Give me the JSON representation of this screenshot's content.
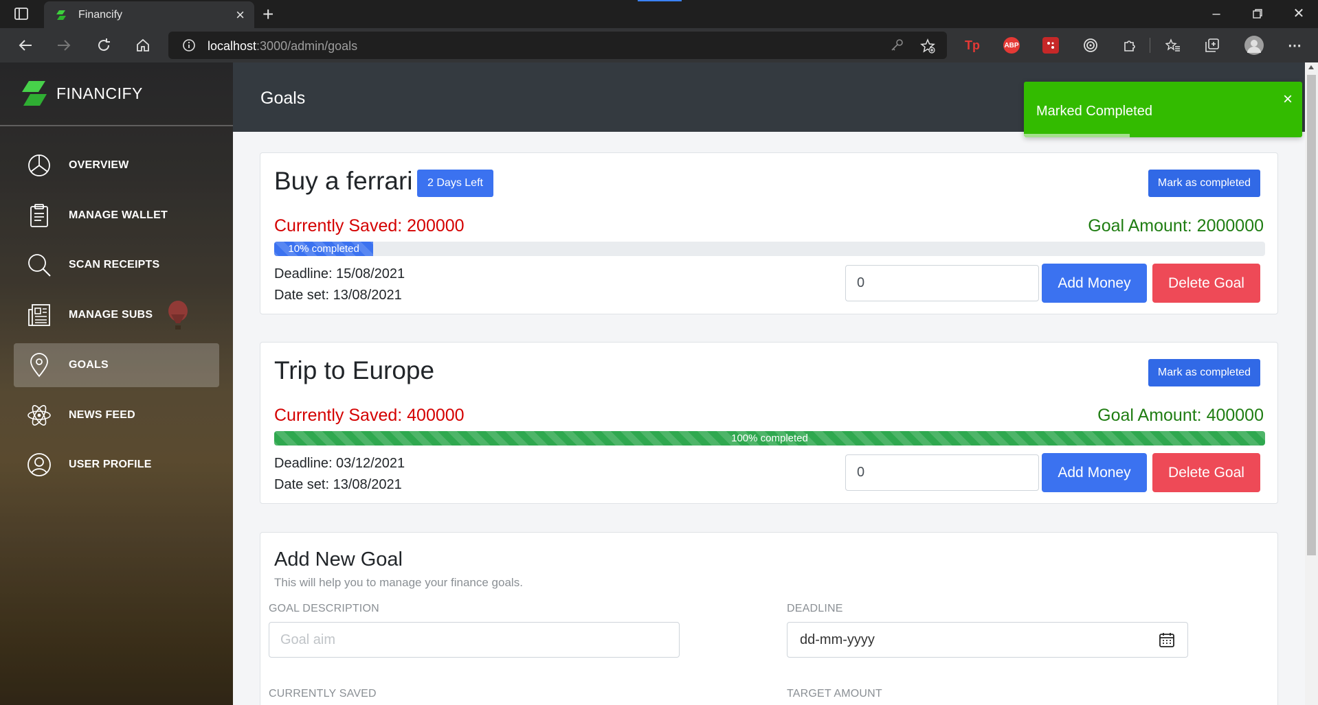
{
  "browser": {
    "tab_title": "Financify",
    "url_host": "localhost",
    "url_path": ":3000/admin/goals",
    "extensions": [
      "Tp",
      "ABP"
    ]
  },
  "sidebar": {
    "brand": "FINANCIFY",
    "items": [
      {
        "label": "OVERVIEW",
        "icon": "pie-chart-icon"
      },
      {
        "label": "MANAGE WALLET",
        "icon": "clipboard-icon"
      },
      {
        "label": "SCAN RECEIPTS",
        "icon": "search-icon"
      },
      {
        "label": "MANAGE SUBS",
        "icon": "newspaper-icon"
      },
      {
        "label": "GOALS",
        "icon": "map-pin-icon",
        "active": true
      },
      {
        "label": "NEWS FEED",
        "icon": "atom-icon"
      },
      {
        "label": "USER PROFILE",
        "icon": "user-circle-icon"
      }
    ]
  },
  "header": {
    "title": "Goals"
  },
  "toast": {
    "message": "Marked Completed",
    "close": "×",
    "progress_remaining_pct": 38
  },
  "goals": [
    {
      "title": "Buy a ferrari",
      "badge": "2 Days Left",
      "mark_label": "Mark as completed",
      "saved": "Currently Saved: 200000",
      "goal_amount": "Goal Amount: 2000000",
      "progress_pct": 10,
      "progress_label": "10% completed",
      "progress_color": "#3b72f0",
      "deadline": "Deadline: 15/08/2021",
      "date_set": "Date set: 13/08/2021",
      "amount_value": "0",
      "add_label": "Add Money",
      "delete_label": "Delete Goal"
    },
    {
      "title": "Trip to Europe",
      "badge": "",
      "mark_label": "Mark as completed",
      "saved": "Currently Saved: 400000",
      "goal_amount": "Goal Amount: 400000",
      "progress_pct": 100,
      "progress_label": "100% completed",
      "progress_color": "#2fa84f",
      "deadline": "Deadline: 03/12/2021",
      "date_set": "Date set: 13/08/2021",
      "amount_value": "0",
      "add_label": "Add Money",
      "delete_label": "Delete Goal"
    }
  ],
  "new_goal": {
    "title": "Add New Goal",
    "subtitle": "This will help you to manage your finance goals.",
    "description_label": "GOAL DESCRIPTION",
    "description_placeholder": "Goal aim",
    "deadline_label": "DEADLINE",
    "deadline_placeholder": "dd-mm-yyyy",
    "saved_label": "CURRENTLY SAVED",
    "target_label": "TARGET AMOUNT"
  },
  "colors": {
    "primary": "#3b72f0",
    "danger": "#ee4a57",
    "saved_text": "#d40000",
    "goal_text": "#1f7d12",
    "toast_bg": "#33bb00",
    "header_bg": "#343a40"
  }
}
